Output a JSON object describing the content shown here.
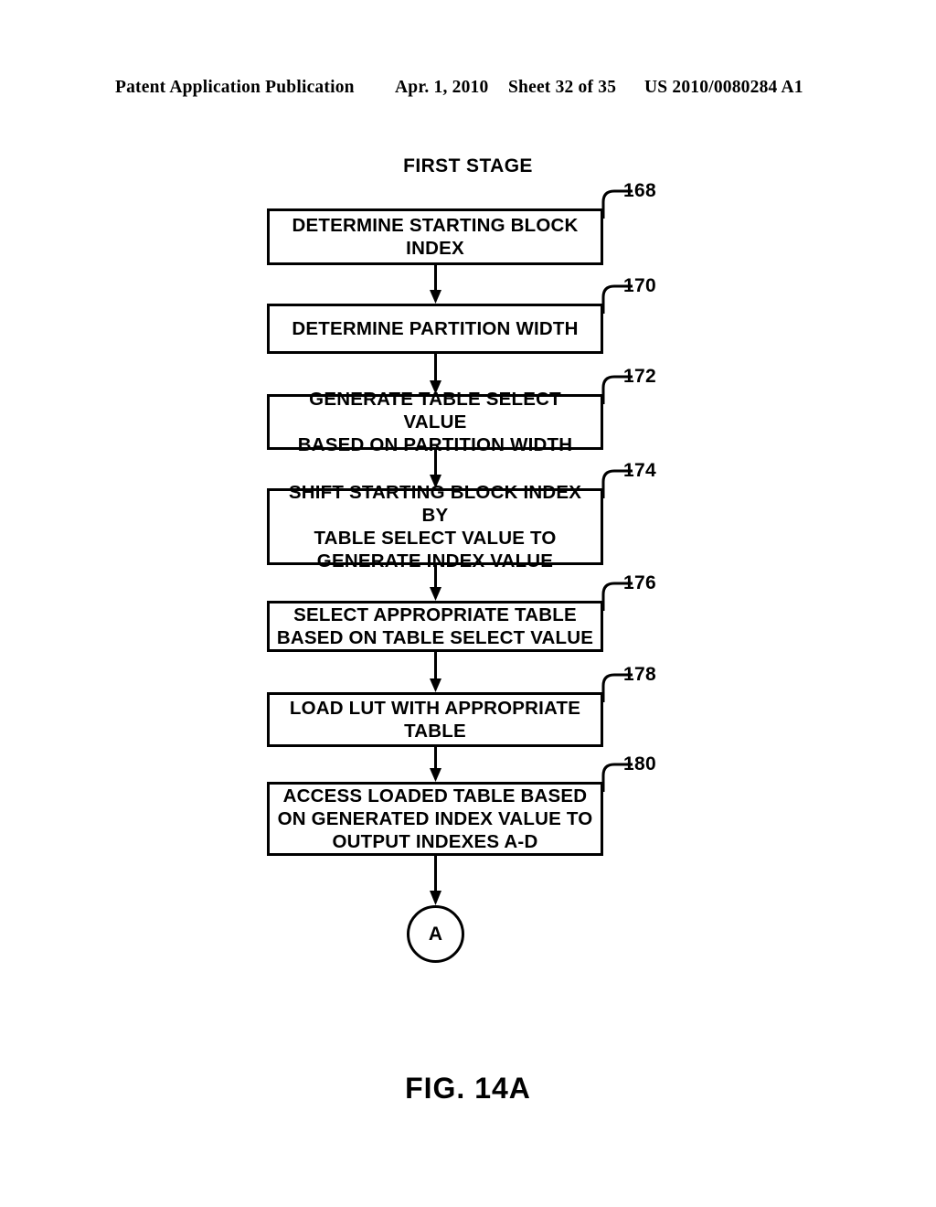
{
  "header": {
    "publication": "Patent Application Publication",
    "date": "Apr. 1, 2010",
    "sheet": "Sheet 32 of 35",
    "patent_number": "US 2010/0080284 A1"
  },
  "figure": {
    "caption": "FIG. 14A",
    "stage_title": "FIRST STAGE",
    "connector": {
      "label": "A",
      "name": "connector-a"
    },
    "steps": [
      {
        "ref": "168",
        "text": "DETERMINE STARTING BLOCK\nINDEX",
        "name": "determine-starting-block-index"
      },
      {
        "ref": "170",
        "text": "DETERMINE PARTITION WIDTH",
        "name": "determine-partition-width"
      },
      {
        "ref": "172",
        "text": "GENERATE TABLE SELECT VALUE\nBASED ON PARTITION WIDTH",
        "name": "generate-table-select-value"
      },
      {
        "ref": "174",
        "text": "SHIFT STARTING BLOCK INDEX BY\nTABLE SELECT VALUE TO\nGENERATE INDEX VALUE",
        "name": "shift-starting-block-index"
      },
      {
        "ref": "176",
        "text": "SELECT APPROPRIATE TABLE\nBASED ON TABLE SELECT VALUE",
        "name": "select-appropriate-table"
      },
      {
        "ref": "178",
        "text": "LOAD LUT WITH APPROPRIATE\nTABLE",
        "name": "load-lut-with-appropriate-table"
      },
      {
        "ref": "180",
        "text": "ACCESS LOADED TABLE BASED\nON GENERATED INDEX VALUE TO\nOUTPUT INDEXES A-D",
        "name": "access-loaded-table"
      }
    ]
  },
  "colors": {
    "ink": "#000000",
    "paper": "#ffffff"
  }
}
